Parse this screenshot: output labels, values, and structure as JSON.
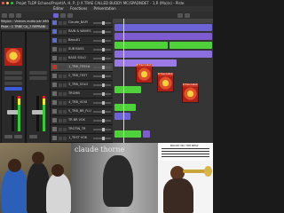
{
  "window": {
    "title": "Projet TLDP Echoes/Projet(A, H, P, J) X TRAE CALLED BUDDY MC/SPADNDET - 1,R (Ma)(s) - Piste"
  },
  "menu": {
    "items": [
      "Éditer",
      "Fonctions",
      "Présentation"
    ]
  },
  "inspector": {
    "region_header": "Région : Valeurs audio par défaut",
    "track_header": "Piste : 1 TRBE CA_7 REPRANI"
  },
  "tracks": [
    {
      "name": "Claude_BAPI"
    },
    {
      "name": "RAIN & WAVES"
    },
    {
      "name": "Bass#1"
    },
    {
      "name": "SUB BASS"
    },
    {
      "name": "BASS SOLO"
    },
    {
      "name": "1_TRB_TESS#"
    },
    {
      "name": "2_TRB_TEST"
    },
    {
      "name": "3_TRB_SOLO"
    },
    {
      "name": "TROMB"
    },
    {
      "name": "4_TRB_VOIX"
    },
    {
      "name": "5_TRB_BR_FLUT"
    },
    {
      "name": "TR BR VOX"
    },
    {
      "name": "TROTIN_TR"
    },
    {
      "name": "1_TEST VOK"
    }
  ],
  "regions": {
    "cover_labels": [
      "B Trae Called Buddy",
      "B Trae Called Buddy",
      "B Trae Called Buddy"
    ]
  },
  "photos": {
    "album_artist_text": "claude thorne",
    "sheet_title": "BUDDY MC THE BEST"
  },
  "colors": {
    "accent_blue": "#6c63d6",
    "region_purple": "#7e5bd1",
    "region_green": "#4fd13a",
    "region_red": "#c8331f",
    "background": "#1a1a1a"
  }
}
